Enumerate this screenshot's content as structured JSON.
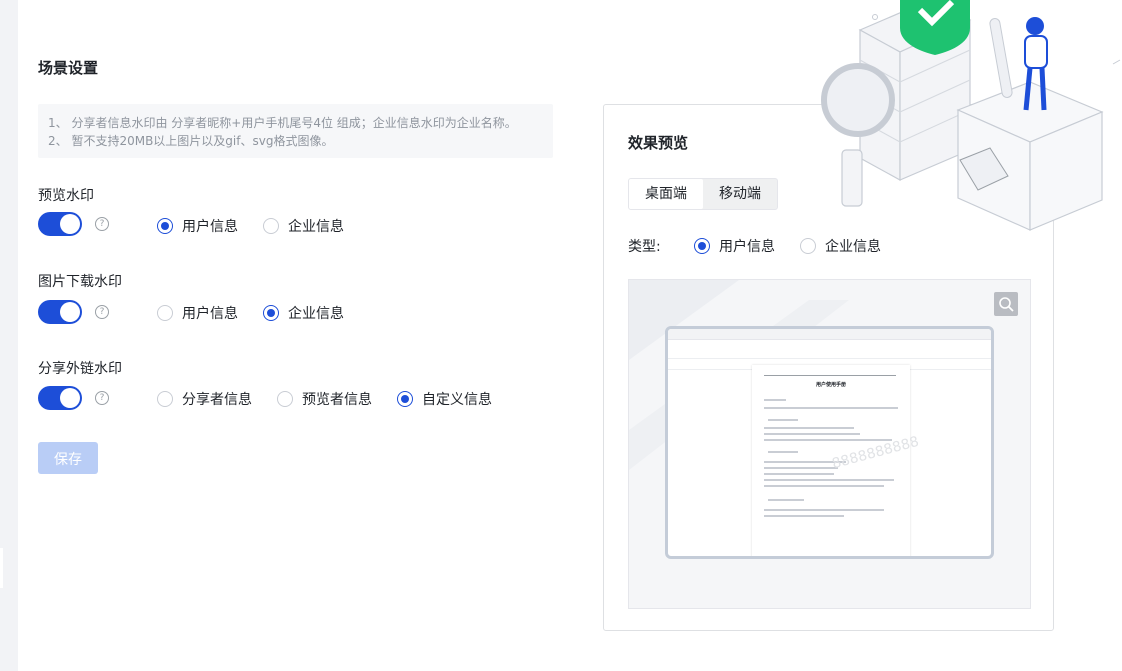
{
  "settings": {
    "title": "场景设置",
    "notices": [
      "1、 分享者信息水印由 分享者昵称+用户手机尾号4位 组成；企业信息水印为企业名称。",
      "2、 暂不支持20MB以上图片以及gif、svg格式图像。"
    ],
    "preview_watermark": {
      "label": "预览水印",
      "enabled": true,
      "options": [
        "用户信息",
        "企业信息"
      ],
      "selected": "用户信息"
    },
    "download_watermark": {
      "label": "图片下载水印",
      "enabled": true,
      "options": [
        "用户信息",
        "企业信息"
      ],
      "selected": "企业信息"
    },
    "share_watermark": {
      "label": "分享外链水印",
      "enabled": true,
      "options": [
        "分享者信息",
        "预览者信息",
        "自定义信息"
      ],
      "selected": "自定义信息"
    },
    "save_label": "保存",
    "help_glyph": "?"
  },
  "preview": {
    "title": "效果预览",
    "tabs": [
      "桌面端",
      "移动端"
    ],
    "active_tab": "桌面端",
    "type_label": "类型:",
    "type_options": [
      "用户信息",
      "企业信息"
    ],
    "type_selected": "用户信息",
    "doc_title": "用户使用手册",
    "doc_watermark": "8888888888"
  },
  "colors": {
    "primary": "#1d4ed8",
    "disabled_button": "#b9cdf6"
  },
  "icons": [
    "question-circle-icon",
    "zoom-icon"
  ]
}
